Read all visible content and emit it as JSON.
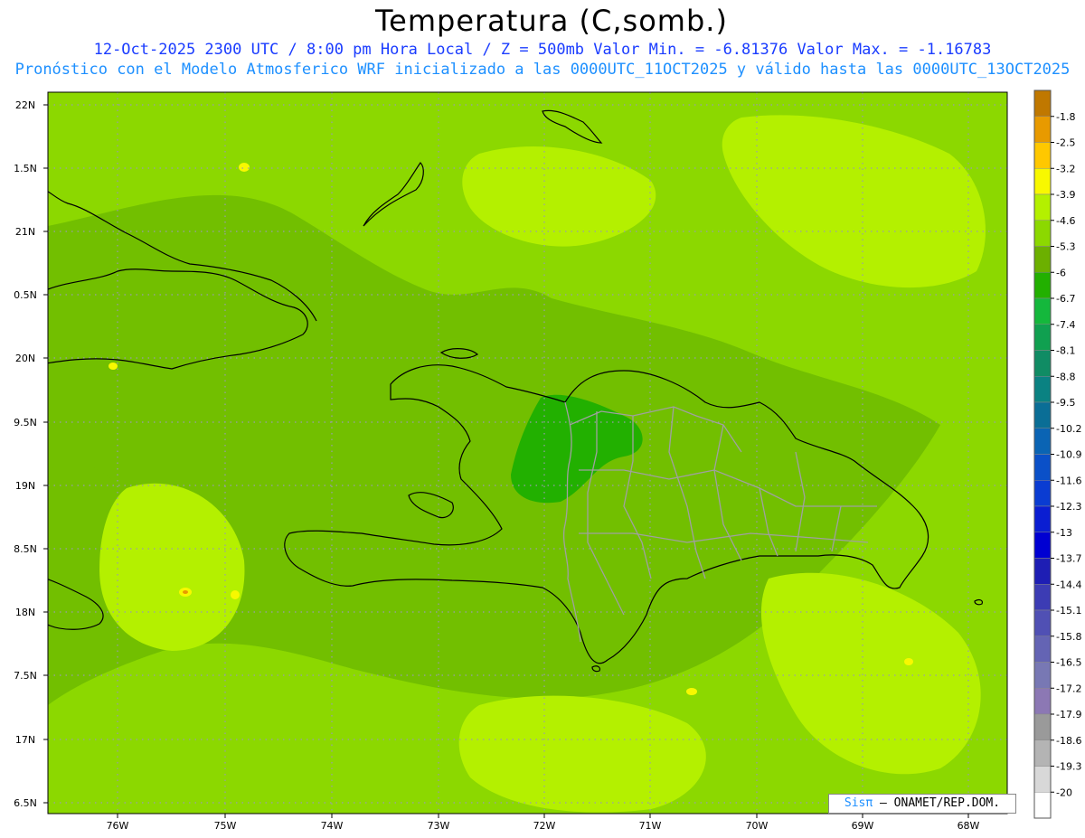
{
  "header": {
    "title": "Temperatura (C,somb.)",
    "line1": "12-Oct-2025  2300 UTC / 8:00 pm Hora Local / Z = 500mb  Valor Min. = -6.81376  Valor Max. = -1.16783",
    "line2": "Pronóstico con el Modelo Atmosferico WRF inicializado a las 0000UTC_11OCT2025 y válido hasta las  0000UTC_13OCT2025"
  },
  "axes": {
    "lat_labels": [
      "22N",
      "1.5N",
      "21N",
      "0.5N",
      "20N",
      "9.5N",
      "19N",
      "8.5N",
      "18N",
      "7.5N",
      "17N",
      "6.5N"
    ],
    "lon_labels": [
      "76W",
      "75W",
      "74W",
      "73W",
      "72W",
      "71W",
      "70W",
      "69W",
      "68W"
    ]
  },
  "colorbar": {
    "labels": [
      "-1.8",
      "-2.5",
      "-3.2",
      "-3.9",
      "-4.6",
      "-5.3",
      "-6",
      "-6.7",
      "-7.4",
      "-8.1",
      "-8.8",
      "-9.5",
      "-10.2",
      "-10.9",
      "-11.6",
      "-12.3",
      "-13",
      "-13.7",
      "-14.4",
      "-15.1",
      "-15.8",
      "-16.5",
      "-17.2",
      "-17.9",
      "-18.6",
      "-19.3",
      "-20"
    ],
    "colors": [
      "#c07800",
      "#e89a00",
      "#ffc800",
      "#f8f800",
      "#b4f000",
      "#8cd800",
      "#6cb000",
      "#22b000",
      "#14b83c",
      "#10a050",
      "#108c64",
      "#0a8282",
      "#0a6e96",
      "#0a64b4",
      "#0a50c8",
      "#0a3cd2",
      "#0a1ed2",
      "#0000d2",
      "#1e1eb4",
      "#3c3cb4",
      "#5050b4",
      "#6464b4",
      "#7878b4",
      "#8c78b4",
      "#9a9a9a",
      "#b4b4b4",
      "#d8d8d8",
      "#ffffff"
    ]
  },
  "field_colors": {
    "light": "#b4f000",
    "base": "#8cd800",
    "mid": "#72bf00",
    "dark": "#22b000",
    "yellow": "#f8f800",
    "orange": "#e89a00",
    "coast": "#000000",
    "border": "#a0a0a0",
    "grid": "#9a9ab0"
  },
  "credit": {
    "brand": "Sisπ",
    "text": "– ONAMET/REP.DOM."
  }
}
